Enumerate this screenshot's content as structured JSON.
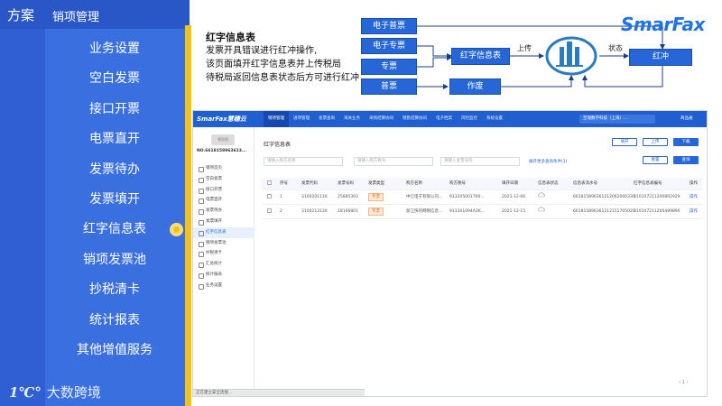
{
  "header": {
    "section": "方案",
    "title": "销项管理"
  },
  "menu": {
    "items": [
      "业务设置",
      "空白发票",
      "接口开票",
      "电票直开",
      "发票待办",
      "发票填开",
      "红字信息表",
      "销项发票池",
      "抄税清卡",
      "统计报表",
      "其他增值服务"
    ],
    "active_index": 6
  },
  "logo": {
    "mark": "1℃°",
    "text": "大数跨境"
  },
  "description": {
    "title": "红字信息表",
    "lines": [
      "发票开具错误进行红冲操作,",
      "该页面填开红字信息表并上传税局",
      "待税局返回信息表状态后方可进行红冲"
    ]
  },
  "flow": {
    "brand": "SmarFax",
    "boxes": {
      "e_normal": "电子普票",
      "e_special": "电子专票",
      "special": "专票",
      "normal": "普票",
      "red_info": "红字信息表",
      "void": "作废",
      "red_flush": "红冲"
    },
    "labels": {
      "upload": "上传",
      "status": "状态"
    }
  },
  "app": {
    "brand": "SmarFax慧穗云",
    "nav": [
      "销项管理",
      "进项管理",
      "发票查询",
      "海关业务",
      "采购结算协同",
      "销售结算协同",
      "电子档案",
      "风险监控",
      "系统设置"
    ],
    "nav_active": 0,
    "org": "至瑞数字科技（上海）...",
    "user": "商品通",
    "stamp": "零报税",
    "tax_no": "NO.6618158963613...",
    "side_items": [
      "销项首页",
      "空白发票",
      "接口开票",
      "电票直开",
      "发票待办",
      "发票填开",
      "红字信息表",
      "销项发票池",
      "抄税清卡",
      "汇总统计",
      "统计报表",
      "业务设置"
    ],
    "side_active": 6,
    "page_title": "红字信息表",
    "buttons": {
      "fill": "填开",
      "upload": "上传",
      "download": "下载",
      "reset": "重置",
      "query": "查询"
    },
    "filters": [
      "请输入购方名称",
      "请输入购方税号",
      "请输入发票号码"
    ],
    "more_link": "展开更多查询条件(1)",
    "columns": [
      "序号",
      "发票代码",
      "发票号码",
      "发票类型",
      "购方名称",
      "购方税号",
      "填开日期",
      "信息表状态",
      "信息表流水号",
      "红字信息表编号",
      "操作"
    ],
    "rows": [
      {
        "no": "1",
        "code": "3100201130",
        "number": "25885393",
        "type": "专票",
        "buyer": "中亿电子有限公司...",
        "tax_no": "913205001760...",
        "date": "2021-12-06",
        "serial": "661815896361212062000339",
        "red_no": "310107211200892929",
        "op": "操作"
      },
      {
        "no": "2",
        "code": "3100213130",
        "number": "18166801",
        "type": "专票",
        "buyer": "浙江快的网络信息...",
        "tax_no": "913301094A2K...",
        "date": "2021-12-15",
        "serial": "661815896361212151705020",
        "red_no": "310107211200489890",
        "op": "操作"
      }
    ],
    "pager": "‹ 1 ›",
    "status_bar": "正在建立安全连接..."
  }
}
